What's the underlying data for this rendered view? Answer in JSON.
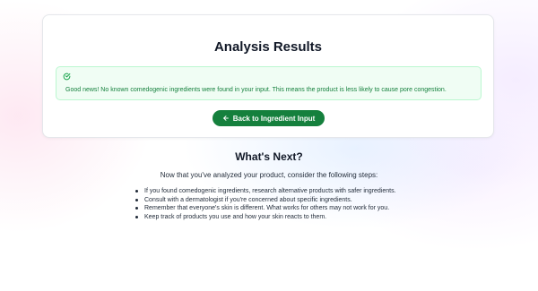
{
  "results": {
    "title": "Analysis Results",
    "alert": {
      "icon": "check-circle-icon",
      "message": "Good news! No known comedogenic ingredients were found in your input. This means the product is less likely to cause pore congestion."
    },
    "back_button": {
      "icon": "arrow-left-icon",
      "label": "Back to Ingredient Input"
    }
  },
  "whats_next": {
    "title": "What's Next?",
    "intro": "Now that you've analyzed your product, consider the following steps:",
    "steps": [
      "If you found comedogenic ingredients, research alternative products with safer ingredients.",
      "Consult with a dermatologist if you're concerned about specific ingredients.",
      "Remember that everyone's skin is different. What works for others may not work for you.",
      "Keep track of products you use and how your skin reacts to them."
    ]
  },
  "colors": {
    "accent_green": "#15803d",
    "alert_background": "#f0fdf4",
    "alert_border": "#bbf7d0"
  }
}
